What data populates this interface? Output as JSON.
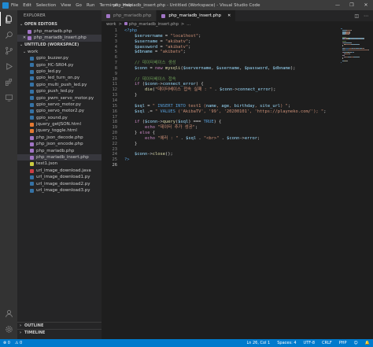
{
  "window": {
    "menu": [
      "File",
      "Edit",
      "Selection",
      "View",
      "Go",
      "Run",
      "Terminal",
      "Help"
    ],
    "title": "php_mariadb_insert.php - Untitled (Workspace) - Visual Studio Code",
    "controls": [
      "—",
      "❐",
      "✕"
    ]
  },
  "sidebar": {
    "title": "EXPLORER",
    "open_editors": {
      "label": "OPEN EDITORS",
      "items": [
        {
          "label": "php_mariadb.php",
          "color": "#a074c4",
          "selected": false
        },
        {
          "label": "php_mariadb_insert.php",
          "color": "#a074c4",
          "selected": true
        }
      ]
    },
    "workspace": {
      "label": "UNTITLED (WORKSPACE)",
      "folder": "work",
      "files": [
        {
          "label": "gpio_buzzer.py",
          "color": "#3572a5"
        },
        {
          "label": "gpio_HC-SR04.py",
          "color": "#3572a5"
        },
        {
          "label": "gpio_led.py",
          "color": "#3572a5"
        },
        {
          "label": "gpio_led_turn_on.py",
          "color": "#3572a5"
        },
        {
          "label": "gpio_multi_push_led.py",
          "color": "#3572a5"
        },
        {
          "label": "gpio_push_led.py",
          "color": "#3572a5"
        },
        {
          "label": "gpio_pwm_servo_motor.py",
          "color": "#3572a5"
        },
        {
          "label": "gpio_servo_motor.py",
          "color": "#3572a5"
        },
        {
          "label": "gpio_servo_motor2.py",
          "color": "#3572a5"
        },
        {
          "label": "gpio_sound.py",
          "color": "#3572a5"
        },
        {
          "label": "jquery_getJSON.html",
          "color": "#e37933"
        },
        {
          "label": "jquery_toggle.html",
          "color": "#e37933"
        },
        {
          "label": "php_json_decode.php",
          "color": "#a074c4"
        },
        {
          "label": "php_json_encode.php",
          "color": "#a074c4"
        },
        {
          "label": "php_mariadb.php",
          "color": "#a074c4"
        },
        {
          "label": "php_mariadb_insert.php",
          "color": "#a074c4",
          "selected": true
        },
        {
          "label": "test1.json",
          "color": "#cbcb41"
        },
        {
          "label": "url_image_download.java",
          "color": "#cc3e44"
        },
        {
          "label": "url_image_download1.py",
          "color": "#3572a5"
        },
        {
          "label": "url_image_download2.py",
          "color": "#3572a5"
        },
        {
          "label": "url_image_download3.py",
          "color": "#3572a5"
        }
      ]
    },
    "outline": "OUTLINE",
    "timeline": "TIMELINE"
  },
  "tabs": [
    {
      "label": "php_mariadb.php",
      "active": false
    },
    {
      "label": "php_mariadb_insert.php",
      "active": true
    }
  ],
  "breadcrumb": [
    "work",
    ">",
    "php_mariadb_insert.php",
    ">",
    "..."
  ],
  "code": [
    [
      [
        "t-tag",
        "<?php"
      ]
    ],
    [
      [
        "t-plain",
        "    "
      ],
      [
        "t-var",
        "$servername"
      ],
      [
        "t-op",
        " = "
      ],
      [
        "t-str",
        "\"localhost\""
      ],
      [
        "t-op",
        ";"
      ]
    ],
    [
      [
        "t-plain",
        "    "
      ],
      [
        "t-var",
        "$username"
      ],
      [
        "t-op",
        " = "
      ],
      [
        "t-str",
        "\"akibatv\""
      ],
      [
        "t-op",
        ";"
      ]
    ],
    [
      [
        "t-plain",
        "    "
      ],
      [
        "t-var",
        "$password"
      ],
      [
        "t-op",
        " = "
      ],
      [
        "t-str",
        "\"akibatv\""
      ],
      [
        "t-op",
        ";"
      ]
    ],
    [
      [
        "t-plain",
        "    "
      ],
      [
        "t-var",
        "$dbname"
      ],
      [
        "t-op",
        " = "
      ],
      [
        "t-str",
        "\"akibatv\""
      ],
      [
        "t-op",
        ";"
      ]
    ],
    [],
    [
      [
        "t-plain",
        "    "
      ],
      [
        "t-com",
        "// 데이터베이스 생성"
      ]
    ],
    [
      [
        "t-plain",
        "    "
      ],
      [
        "t-var",
        "$conn"
      ],
      [
        "t-op",
        " = "
      ],
      [
        "t-kw",
        "new "
      ],
      [
        "t-fn",
        "mysqli"
      ],
      [
        "t-op",
        "("
      ],
      [
        "t-var",
        "$servername"
      ],
      [
        "t-op",
        ", "
      ],
      [
        "t-var",
        "$username"
      ],
      [
        "t-op",
        ", "
      ],
      [
        "t-var",
        "$password"
      ],
      [
        "t-op",
        ", "
      ],
      [
        "t-var",
        "$dbname"
      ],
      [
        "t-op",
        ");"
      ]
    ],
    [],
    [
      [
        "t-plain",
        "    "
      ],
      [
        "t-com",
        "// 데이터베이스 접속"
      ]
    ],
    [
      [
        "t-plain",
        "    "
      ],
      [
        "t-kw",
        "if"
      ],
      [
        "t-op",
        " ("
      ],
      [
        "t-var",
        "$conn"
      ],
      [
        "t-op",
        "->"
      ],
      [
        "t-var",
        "connect_error"
      ],
      [
        "t-op",
        ") {"
      ]
    ],
    [
      [
        "t-plain",
        "        "
      ],
      [
        "t-fn",
        "die"
      ],
      [
        "t-op",
        "("
      ],
      [
        "t-str",
        "\"데이터베이스 접속 실패 : \""
      ],
      [
        "t-op",
        " . "
      ],
      [
        "t-var",
        "$conn"
      ],
      [
        "t-op",
        "->"
      ],
      [
        "t-var",
        "connect_error"
      ],
      [
        "t-op",
        ");"
      ]
    ],
    [
      [
        "t-plain",
        "    "
      ],
      [
        "t-op",
        "}"
      ]
    ],
    [],
    [
      [
        "t-plain",
        "    "
      ],
      [
        "t-var",
        "$sql"
      ],
      [
        "t-op",
        " = "
      ],
      [
        "t-str",
        "\" "
      ],
      [
        "t-const",
        "INSERT INTO"
      ],
      [
        "t-str",
        " test1 ("
      ],
      [
        "t-var",
        "name"
      ],
      [
        "t-str",
        ", "
      ],
      [
        "t-var",
        "age"
      ],
      [
        "t-str",
        ", "
      ],
      [
        "t-var",
        "birthday"
      ],
      [
        "t-str",
        ", "
      ],
      [
        "t-var",
        "site_url"
      ],
      [
        "t-str",
        ") \""
      ],
      [
        "t-op",
        ";"
      ]
    ],
    [
      [
        "t-plain",
        "    "
      ],
      [
        "t-var",
        "$sql"
      ],
      [
        "t-op",
        " .= "
      ],
      [
        "t-str",
        "\" "
      ],
      [
        "t-const",
        "VALUES"
      ],
      [
        "t-str",
        " ('AkibaTV', '99', '20200101', 'https://playneko.com/'); \""
      ],
      [
        "t-op",
        ";"
      ]
    ],
    [],
    [
      [
        "t-plain",
        "    "
      ],
      [
        "t-kw",
        "if"
      ],
      [
        "t-op",
        " ("
      ],
      [
        "t-var",
        "$conn"
      ],
      [
        "t-op",
        "->"
      ],
      [
        "t-fn",
        "query"
      ],
      [
        "t-op",
        "("
      ],
      [
        "t-var",
        "$sql"
      ],
      [
        "t-op",
        ") === "
      ],
      [
        "t-const",
        "TRUE"
      ],
      [
        "t-op",
        ") {"
      ]
    ],
    [
      [
        "t-plain",
        "        "
      ],
      [
        "t-kw",
        "echo"
      ],
      [
        "t-op",
        " "
      ],
      [
        "t-str",
        "\"데이터 추가 성공\""
      ],
      [
        "t-op",
        ";"
      ]
    ],
    [
      [
        "t-plain",
        "    "
      ],
      [
        "t-op",
        "} "
      ],
      [
        "t-kw",
        "else"
      ],
      [
        "t-op",
        " {"
      ]
    ],
    [
      [
        "t-plain",
        "        "
      ],
      [
        "t-kw",
        "echo"
      ],
      [
        "t-op",
        " "
      ],
      [
        "t-str",
        "\"에러 : \""
      ],
      [
        "t-op",
        " . "
      ],
      [
        "t-var",
        "$sql"
      ],
      [
        "t-op",
        " . "
      ],
      [
        "t-str",
        "\"<br>\""
      ],
      [
        "t-op",
        " . "
      ],
      [
        "t-var",
        "$conn"
      ],
      [
        "t-op",
        "->"
      ],
      [
        "t-var",
        "error"
      ],
      [
        "t-op",
        ";"
      ]
    ],
    [
      [
        "t-plain",
        "    "
      ],
      [
        "t-op",
        "}"
      ]
    ],
    [],
    [
      [
        "t-plain",
        "    "
      ],
      [
        "t-var",
        "$conn"
      ],
      [
        "t-op",
        "->"
      ],
      [
        "t-fn",
        "close"
      ],
      [
        "t-op",
        "();"
      ]
    ],
    [
      [
        "t-tag",
        "?>"
      ]
    ]
  ],
  "statusbar": {
    "left": [
      "⊗ 0",
      "⚠ 0"
    ],
    "right": [
      "Ln 26, Col 1",
      "Spaces: 4",
      "UTF-8",
      "CRLF",
      "PHP",
      "☺",
      "🔔"
    ]
  },
  "colors": {
    "accent": "#007acc",
    "sidebar_bg": "#252526",
    "editor_bg": "#1e1e1e",
    "activity_bg": "#333333",
    "titlebar_bg": "#3c3c3c"
  }
}
